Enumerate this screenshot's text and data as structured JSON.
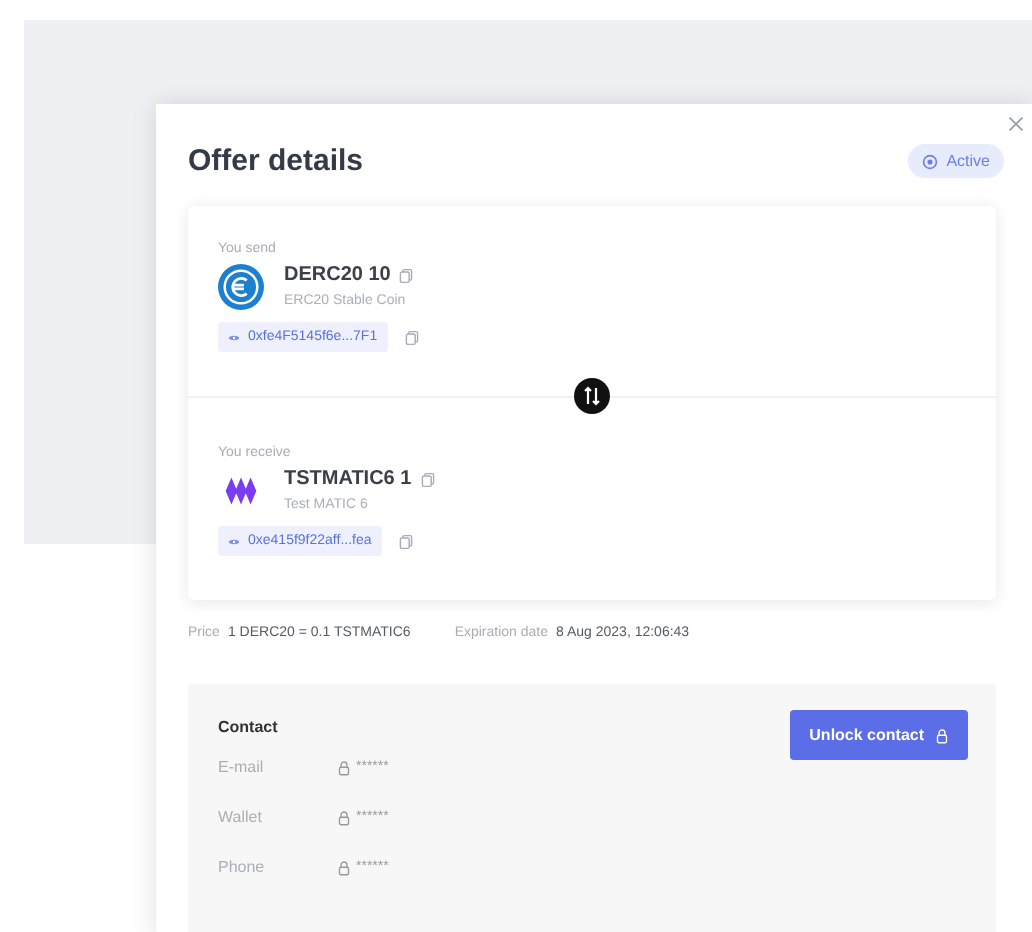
{
  "modal": {
    "title": "Offer details",
    "status": "Active"
  },
  "send": {
    "label": "You send",
    "token": "DERC20 10",
    "name": "ERC20 Stable Coin",
    "address": "0xfe4F5145f6e...7F1",
    "kind": "euro"
  },
  "receive": {
    "label": "You receive",
    "token": "TSTMATIC6 1",
    "name": "Test MATIC 6",
    "address": "0xe415f9f22aff...fea",
    "kind": "matic"
  },
  "price": {
    "label": "Price",
    "value": "1 DERC20 = 0.1 TSTMATIC6"
  },
  "expiration": {
    "label": "Expiration date",
    "value": "8 Aug 2023, 12:06:43"
  },
  "contact": {
    "title": "Contact",
    "button": "Unlock contact",
    "fields": [
      {
        "label": "E-mail",
        "value": "******"
      },
      {
        "label": "Wallet",
        "value": "******"
      },
      {
        "label": "Phone",
        "value": "******"
      }
    ]
  }
}
